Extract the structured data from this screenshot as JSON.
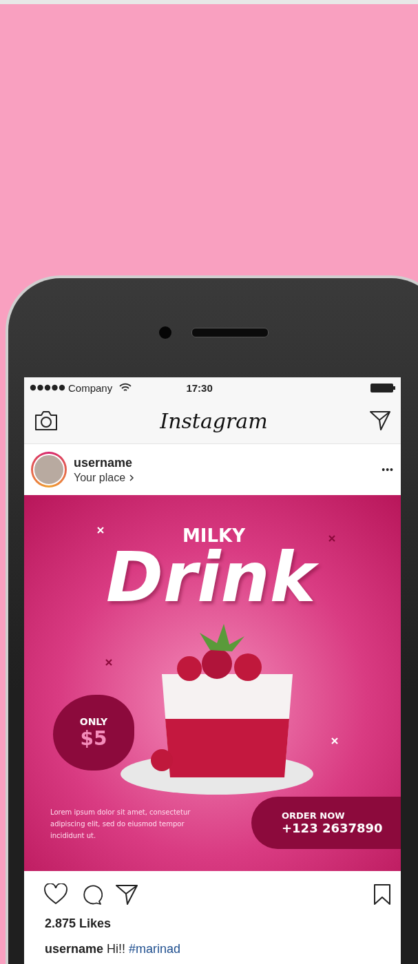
{
  "status_bar": {
    "carrier": "Company",
    "time": "17:30"
  },
  "header": {
    "title": "Instagram"
  },
  "post": {
    "username": "username",
    "place": "Your place",
    "menu": "•••",
    "ad": {
      "kicker": "MILKY",
      "title": "Drink",
      "price_label": "ONLY",
      "price": "$5",
      "blurb": "Lorem ipsum dolor sit amet, consectetur adipiscing elit, sed do eiusmod tempor incididunt ut.",
      "cta_label": "ORDER NOW",
      "phone": "+123 2637890"
    },
    "likes": "2.875 Likes",
    "caption": {
      "text": "**username** Hi!!",
      "hashtag": "#marinad"
    }
  }
}
